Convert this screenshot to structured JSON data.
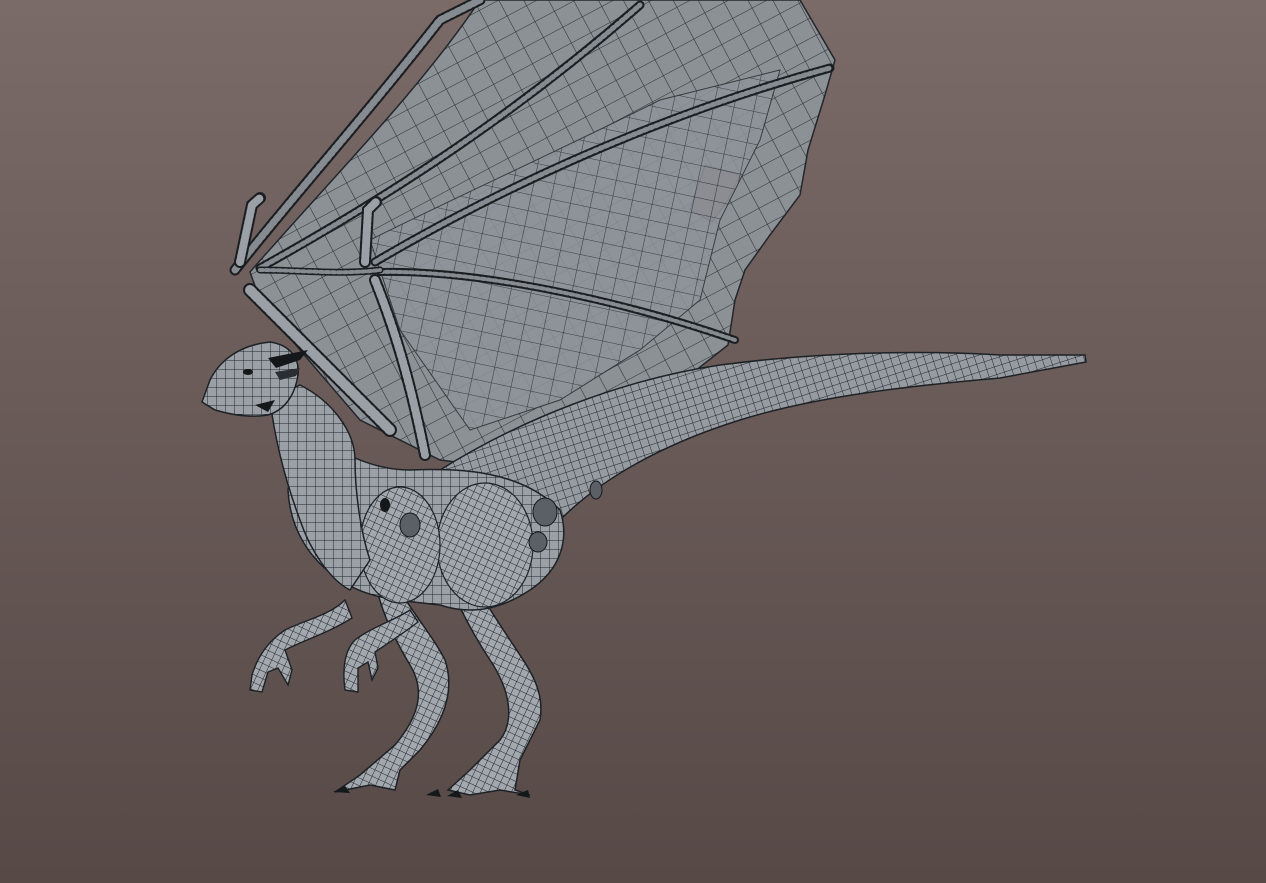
{
  "viewport": {
    "background_top": "#7a6a68",
    "background_bottom": "#564946",
    "mesh_fill": "#8b9096",
    "mesh_fill_light": "#a9aeb4",
    "wire_color": "#1e2226",
    "dark_accent": "#15181b"
  },
  "model": {
    "icon": "dragon-wireframe-model"
  }
}
